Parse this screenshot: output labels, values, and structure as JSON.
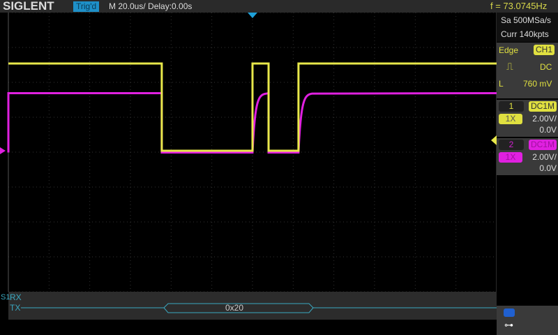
{
  "header": {
    "logo": "SIGLENT",
    "trigger_status": "Trig'd",
    "timebase": "M 20.0us/  Delay:0.00s",
    "frequency": "f = 73.0745Hz"
  },
  "acquisition": {
    "sample_rate": "Sa 500MSa/s",
    "memory": "Curr 140kpts"
  },
  "trigger": {
    "type": "Edge",
    "source": "CH1",
    "slope_icon": "rising-edge-icon",
    "coupling": "DC",
    "level_label": "L",
    "level": "760 mV"
  },
  "channels": [
    {
      "num": "1",
      "coupling": "DC1M",
      "probe": "1X",
      "scale": "2.00V/",
      "offset": "0.0V",
      "color": "#e8e84a"
    },
    {
      "num": "2",
      "coupling": "DC1M",
      "probe": "1X",
      "scale": "2.00V/",
      "offset": "0.0V",
      "color": "#e020e0"
    }
  ],
  "decode": {
    "bus": "S1",
    "rx_label": "RX",
    "tx_label": "TX",
    "tx_value": "0x20",
    "color": "#3aa8c0"
  },
  "waveform": {
    "time_per_div_us": 20,
    "volts_per_div": 2,
    "ch1_segments_us": [
      [
        -140,
        -44.6,
        5
      ],
      [
        -44.6,
        0,
        0
      ],
      [
        0,
        7.9,
        5
      ],
      [
        7.9,
        22.6,
        0
      ],
      [
        22.6,
        120,
        5
      ]
    ],
    "ch2_high_v": 3.3,
    "ch2_low_v": -0.1
  },
  "status_icons": [
    "usb-icon",
    "network-icon"
  ]
}
